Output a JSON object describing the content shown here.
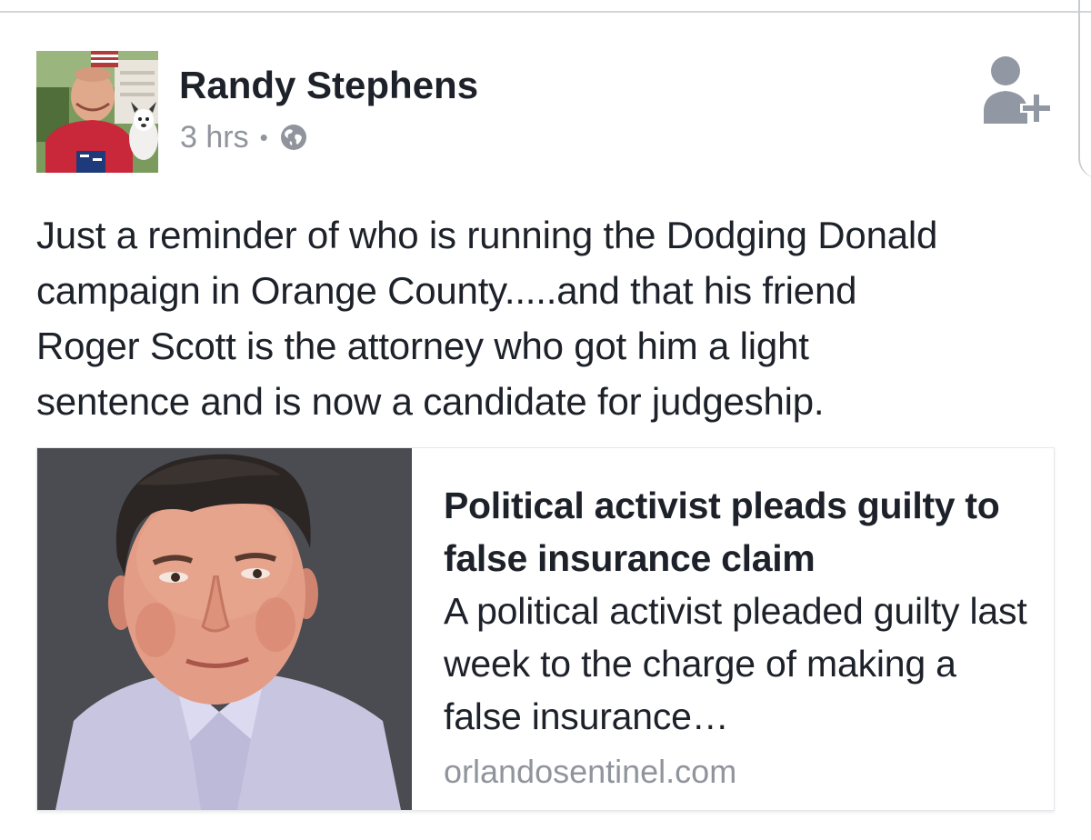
{
  "post": {
    "author_name": "Randy Stephens",
    "timestamp": "3 hrs",
    "separator": "•",
    "privacy_icon": "globe-icon",
    "add_friend_icon": "add-friend-icon",
    "text": "Just a reminder of who is running the Dodging Donald\ncampaign in Orange County.....and that his friend\nRoger Scott is the attorney who got him a light\nsentence and is now a candidate for judgeship."
  },
  "link_preview": {
    "title": "Political activist pleads guilty to false insurance claim",
    "description": "A political activist pleaded guilty last week to the charge of making a false insurance…",
    "domain": "orlandosentinel.com"
  },
  "colors": {
    "text_primary": "#1d2129",
    "text_secondary": "#90949c",
    "icon_gray": "#9197a3",
    "card_border": "#e5e7ea"
  }
}
